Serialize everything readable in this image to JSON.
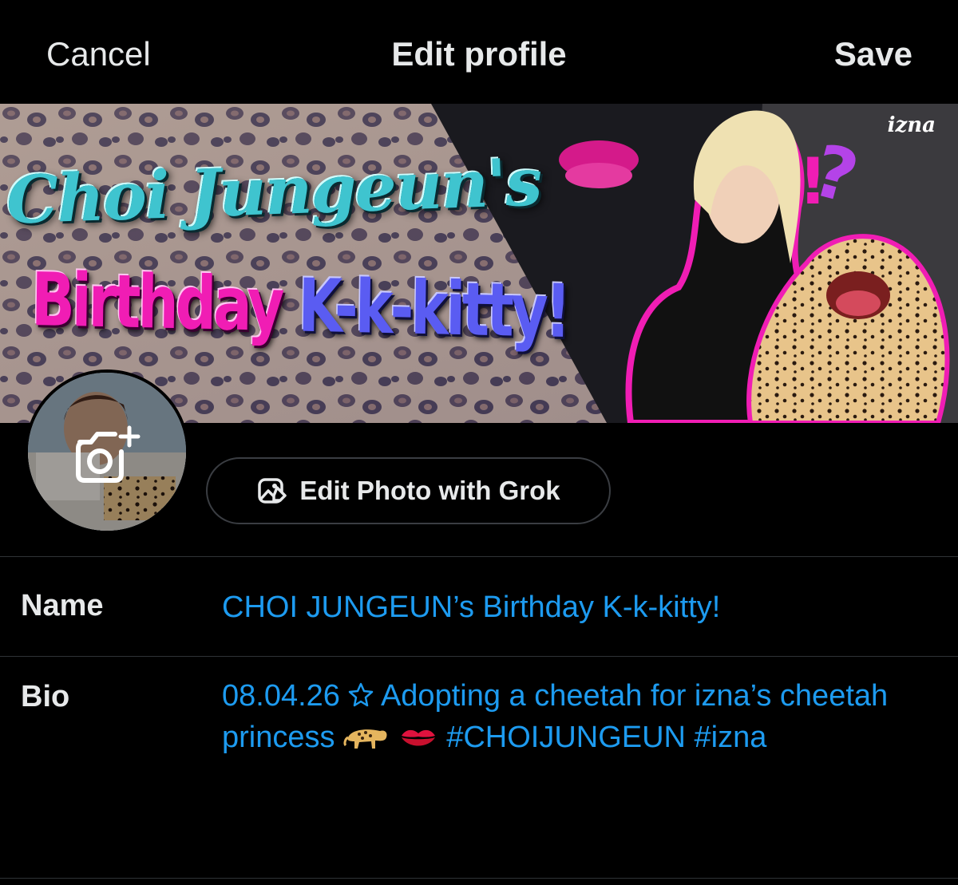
{
  "header": {
    "cancel_label": "Cancel",
    "title": "Edit profile",
    "save_label": "Save"
  },
  "banner": {
    "line1": "Choi Jungeun's",
    "line2_pink": "Birthday ",
    "line2_blue": "K-k-kitty!",
    "logo_text": "izna",
    "accent_pink": "#f01db4",
    "accent_teal": "#3fc4cf"
  },
  "avatar": {
    "overlay_icon": "add-photo-icon"
  },
  "grok_button": {
    "label": "Edit Photo with Grok",
    "icon": "ai-image-edit-icon"
  },
  "fields": {
    "name_label": "Name",
    "name_value": "CHOI JUNGEUN’s Birthday K-k-kitty!",
    "bio_label": "Bio",
    "bio_part1": "08.04.26",
    "bio_part2": "Adopting a cheetah for izna’s cheetah princess",
    "bio_part3": "#CHOIJUNGEUN #izna"
  },
  "colors": {
    "background": "#000000",
    "text": "#e7e9ea",
    "link": "#1d9bf0",
    "divider": "#2f3336"
  }
}
